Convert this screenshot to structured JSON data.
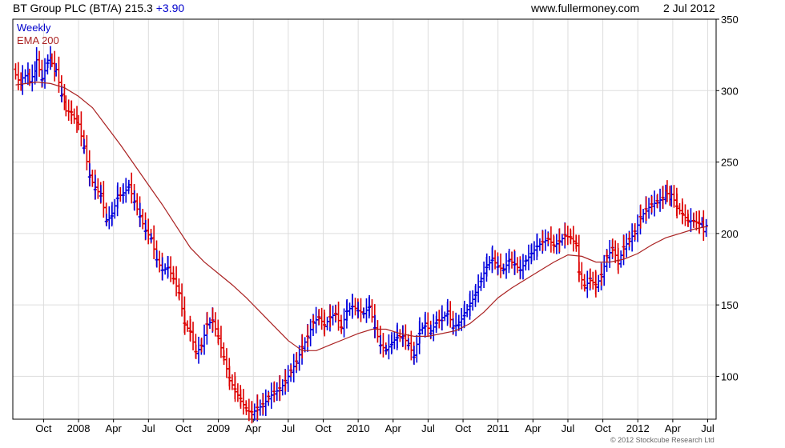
{
  "header": {
    "ticker": "BT Group PLC (BT/A)",
    "price": "215.3",
    "change": "+3.90",
    "site": "www.fullermoney.com",
    "date": "2 Jul 2012"
  },
  "legend": {
    "weekly": "Weekly",
    "ema": "EMA 200"
  },
  "copyright": "© 2012 Stockcube Research Ltd",
  "chart_data": {
    "type": "line",
    "title": "BT Group PLC (BT/A) 215.3 +3.90",
    "ylim": [
      70,
      350
    ],
    "y_ticks": [
      100,
      150,
      200,
      250,
      300,
      350
    ],
    "x_ticks": [
      {
        "label": "Oct",
        "x": 2007.75
      },
      {
        "label": "2008",
        "x": 2008.0
      },
      {
        "label": "Apr",
        "x": 2008.25
      },
      {
        "label": "Jul",
        "x": 2008.5
      },
      {
        "label": "Oct",
        "x": 2008.75
      },
      {
        "label": "2009",
        "x": 2009.0
      },
      {
        "label": "Apr",
        "x": 2009.25
      },
      {
        "label": "Jul",
        "x": 2009.5
      },
      {
        "label": "Oct",
        "x": 2009.75
      },
      {
        "label": "2010",
        "x": 2010.0
      },
      {
        "label": "Apr",
        "x": 2010.25
      },
      {
        "label": "Jul",
        "x": 2010.5
      },
      {
        "label": "Oct",
        "x": 2010.75
      },
      {
        "label": "2011",
        "x": 2011.0
      },
      {
        "label": "Apr",
        "x": 2011.25
      },
      {
        "label": "Jul",
        "x": 2011.5
      },
      {
        "label": "Oct",
        "x": 2011.75
      },
      {
        "label": "2012",
        "x": 2012.0
      },
      {
        "label": "Apr",
        "x": 2012.25
      },
      {
        "label": "Jul",
        "x": 2012.5
      }
    ],
    "grid": true,
    "series": [
      {
        "name": "Weekly",
        "color_up": "#0000dd",
        "color_down": "#dd0000",
        "points": [
          [
            2007.55,
            315
          ],
          [
            2007.6,
            305
          ],
          [
            2007.65,
            310
          ],
          [
            2007.7,
            318
          ],
          [
            2007.74,
            305
          ],
          [
            2007.78,
            318
          ],
          [
            2007.81,
            322
          ],
          [
            2007.84,
            312
          ],
          [
            2007.88,
            295
          ],
          [
            2007.91,
            288
          ],
          [
            2007.95,
            285
          ],
          [
            2008.0,
            275
          ],
          [
            2008.04,
            260
          ],
          [
            2008.08,
            240
          ],
          [
            2008.12,
            232
          ],
          [
            2008.16,
            228
          ],
          [
            2008.2,
            210
          ],
          [
            2008.24,
            215
          ],
          [
            2008.28,
            228
          ],
          [
            2008.32,
            230
          ],
          [
            2008.36,
            236
          ],
          [
            2008.4,
            225
          ],
          [
            2008.44,
            215
          ],
          [
            2008.48,
            205
          ],
          [
            2008.52,
            200
          ],
          [
            2008.56,
            185
          ],
          [
            2008.6,
            178
          ],
          [
            2008.64,
            180
          ],
          [
            2008.68,
            172
          ],
          [
            2008.72,
            162
          ],
          [
            2008.76,
            140
          ],
          [
            2008.8,
            135
          ],
          [
            2008.84,
            120
          ],
          [
            2008.88,
            125
          ],
          [
            2008.92,
            140
          ],
          [
            2008.96,
            142
          ],
          [
            2009.0,
            130
          ],
          [
            2009.04,
            115
          ],
          [
            2009.08,
            100
          ],
          [
            2009.12,
            92
          ],
          [
            2009.16,
            85
          ],
          [
            2009.2,
            78
          ],
          [
            2009.24,
            75
          ],
          [
            2009.28,
            78
          ],
          [
            2009.32,
            80
          ],
          [
            2009.36,
            85
          ],
          [
            2009.4,
            88
          ],
          [
            2009.44,
            90
          ],
          [
            2009.48,
            95
          ],
          [
            2009.52,
            102
          ],
          [
            2009.56,
            108
          ],
          [
            2009.6,
            118
          ],
          [
            2009.64,
            125
          ],
          [
            2009.68,
            135
          ],
          [
            2009.72,
            138
          ],
          [
            2009.76,
            132
          ],
          [
            2009.8,
            138
          ],
          [
            2009.84,
            140
          ],
          [
            2009.88,
            130
          ],
          [
            2009.92,
            142
          ],
          [
            2009.96,
            145
          ],
          [
            2010.0,
            142
          ],
          [
            2010.04,
            140
          ],
          [
            2010.08,
            145
          ],
          [
            2010.12,
            130
          ],
          [
            2010.16,
            118
          ],
          [
            2010.2,
            115
          ],
          [
            2010.24,
            120
          ],
          [
            2010.28,
            125
          ],
          [
            2010.32,
            125
          ],
          [
            2010.36,
            120
          ],
          [
            2010.4,
            112
          ],
          [
            2010.44,
            130
          ],
          [
            2010.48,
            135
          ],
          [
            2010.52,
            130
          ],
          [
            2010.56,
            138
          ],
          [
            2010.6,
            140
          ],
          [
            2010.64,
            145
          ],
          [
            2010.68,
            135
          ],
          [
            2010.72,
            138
          ],
          [
            2010.76,
            145
          ],
          [
            2010.8,
            152
          ],
          [
            2010.84,
            160
          ],
          [
            2010.88,
            170
          ],
          [
            2010.92,
            180
          ],
          [
            2010.96,
            185
          ],
          [
            2011.0,
            180
          ],
          [
            2011.04,
            178
          ],
          [
            2011.08,
            185
          ],
          [
            2011.12,
            182
          ],
          [
            2011.16,
            178
          ],
          [
            2011.2,
            185
          ],
          [
            2011.24,
            190
          ],
          [
            2011.28,
            195
          ],
          [
            2011.32,
            198
          ],
          [
            2011.36,
            200
          ],
          [
            2011.4,
            195
          ],
          [
            2011.44,
            198
          ],
          [
            2011.48,
            202
          ],
          [
            2011.52,
            200
          ],
          [
            2011.56,
            195
          ],
          [
            2011.58,
            175
          ],
          [
            2011.62,
            165
          ],
          [
            2011.66,
            170
          ],
          [
            2011.7,
            165
          ],
          [
            2011.74,
            172
          ],
          [
            2011.78,
            185
          ],
          [
            2011.82,
            190
          ],
          [
            2011.86,
            180
          ],
          [
            2011.9,
            190
          ],
          [
            2011.94,
            195
          ],
          [
            2011.98,
            200
          ],
          [
            2012.02,
            210
          ],
          [
            2012.06,
            215
          ],
          [
            2012.1,
            218
          ],
          [
            2012.14,
            220
          ],
          [
            2012.18,
            222
          ],
          [
            2012.21,
            230
          ],
          [
            2012.24,
            225
          ],
          [
            2012.28,
            215
          ],
          [
            2012.32,
            210
          ],
          [
            2012.36,
            205
          ],
          [
            2012.4,
            205
          ],
          [
            2012.44,
            203
          ],
          [
            2012.47,
            205
          ],
          [
            2012.5,
            212
          ]
        ]
      },
      {
        "name": "EMA 200",
        "color": "#aa2222",
        "points": [
          [
            2007.55,
            304
          ],
          [
            2007.7,
            306
          ],
          [
            2007.8,
            305
          ],
          [
            2007.9,
            302
          ],
          [
            2008.0,
            296
          ],
          [
            2008.1,
            288
          ],
          [
            2008.2,
            275
          ],
          [
            2008.3,
            262
          ],
          [
            2008.4,
            248
          ],
          [
            2008.5,
            234
          ],
          [
            2008.6,
            220
          ],
          [
            2008.7,
            205
          ],
          [
            2008.8,
            190
          ],
          [
            2008.9,
            180
          ],
          [
            2009.0,
            172
          ],
          [
            2009.1,
            164
          ],
          [
            2009.2,
            155
          ],
          [
            2009.3,
            145
          ],
          [
            2009.4,
            135
          ],
          [
            2009.5,
            125
          ],
          [
            2009.6,
            118
          ],
          [
            2009.7,
            118
          ],
          [
            2009.8,
            122
          ],
          [
            2009.9,
            126
          ],
          [
            2010.0,
            130
          ],
          [
            2010.1,
            133
          ],
          [
            2010.2,
            133
          ],
          [
            2010.3,
            130
          ],
          [
            2010.4,
            128
          ],
          [
            2010.5,
            128
          ],
          [
            2010.6,
            130
          ],
          [
            2010.7,
            132
          ],
          [
            2010.8,
            137
          ],
          [
            2010.9,
            145
          ],
          [
            2011.0,
            155
          ],
          [
            2011.1,
            162
          ],
          [
            2011.2,
            168
          ],
          [
            2011.3,
            174
          ],
          [
            2011.4,
            180
          ],
          [
            2011.5,
            185
          ],
          [
            2011.6,
            184
          ],
          [
            2011.7,
            180
          ],
          [
            2011.8,
            180
          ],
          [
            2011.9,
            182
          ],
          [
            2012.0,
            186
          ],
          [
            2012.1,
            192
          ],
          [
            2012.2,
            197
          ],
          [
            2012.3,
            200
          ],
          [
            2012.4,
            203
          ],
          [
            2012.5,
            205
          ]
        ]
      }
    ]
  }
}
